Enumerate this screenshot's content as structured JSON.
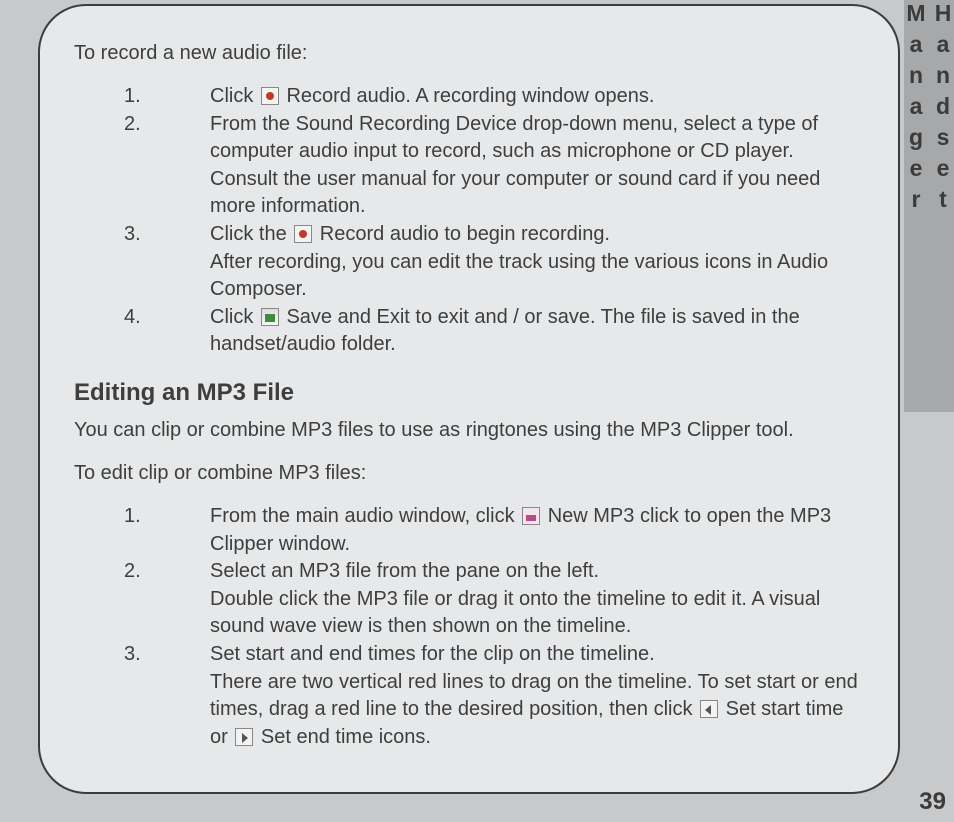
{
  "sideTab": "Handset Manager",
  "pageNumber": "39",
  "section1": {
    "intro": "To record a new audio file:",
    "items": [
      {
        "num": "1.",
        "before": "Click ",
        "icon": "record",
        "after": " Record audio. A recording window opens."
      },
      {
        "num": "2.",
        "before": "From the Sound Recording Device drop-down menu, select a type of computer audio input to record, such as microphone or CD player. Consult the user manual for your computer or sound card if you need more information.",
        "icon": "",
        "after": ""
      },
      {
        "num": "3.",
        "before": "Click the ",
        "icon": "record",
        "after": " Record audio to begin recording.",
        "line2": "After recording, you can edit the track using the various icons in Audio Composer."
      },
      {
        "num": "4.",
        "before": "Click ",
        "icon": "save",
        "after": " Save and Exit to exit and / or save. The file is saved in the handset/audio folder."
      }
    ]
  },
  "heading": "Editing an MP3 File",
  "paragraph": "You can clip or combine MP3 files to use as ringtones using the MP3 Clipper tool.",
  "section2": {
    "intro": "To edit clip or combine MP3 files:",
    "items": [
      {
        "num": "1.",
        "before": "From the main audio window, click ",
        "icon": "mp3",
        "after": " New MP3 click to open the MP3 Clipper window."
      },
      {
        "num": "2.",
        "before": "Select an MP3 file from the pane on the left.",
        "icon": "",
        "after": "",
        "line2": "Double click the MP3 file or drag it onto the timeline to edit it. A visual sound wave view is then shown on the timeline."
      },
      {
        "num": "3.",
        "before": "Set start and end times for the clip on the timeline.",
        "icon": "",
        "after": "",
        "line2a": "There are two vertical red lines to drag on the timeline. To set start or end times, drag a red line to the desired position, then click ",
        "icon2": "start",
        "mid": "  Set start time or ",
        "icon3": "end",
        "endtxt": "  Set end time icons."
      }
    ]
  }
}
